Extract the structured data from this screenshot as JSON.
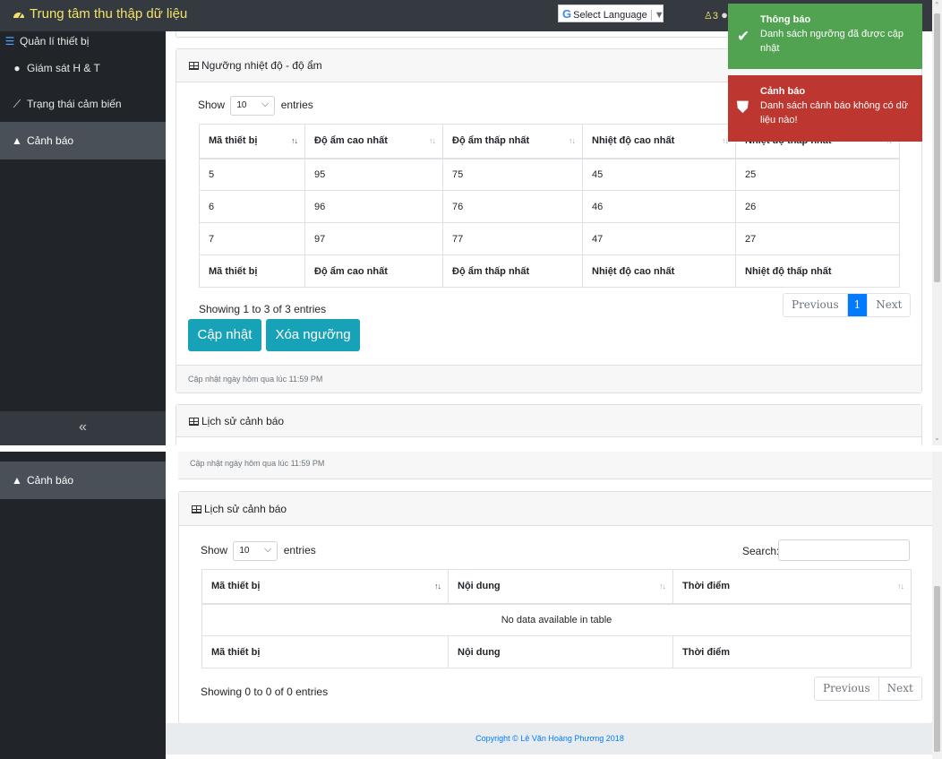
{
  "colors": {
    "navbar": "#343a40",
    "sidebar": "#212529",
    "brand": "#f1e36a",
    "button": "#17a2b8",
    "toast_success": "#51a351",
    "toast_error": "#bd362f",
    "page_active": "#007bff"
  },
  "navbar": {
    "brand": "Trung tâm thu thập dữ liệu",
    "brand_icon": "dashboard-icon",
    "language_label": "Select Language",
    "language_arrow": "▼",
    "notif_count": "3"
  },
  "sidebar": {
    "group_label": "Quản lí thiết bị",
    "items": [
      {
        "label": "Giám sát H & T",
        "icon": "info-circle-icon"
      },
      {
        "label": "Trạng thái cảm biến",
        "icon": "area-chart-icon"
      },
      {
        "label": "Cảnh báo",
        "icon": "warning-icon"
      }
    ],
    "collapse_label": "«"
  },
  "threshold_card": {
    "title": "Ngưỡng nhiệt độ - độ ẩm",
    "show_label": "Show",
    "entries_value": "10",
    "entries_label": "entries",
    "columns": [
      "Mã thiết bị",
      "Độ ẩm cao nhất",
      "Độ ẩm thấp nhất",
      "Nhiệt độ cao nhất",
      "Nhiệt độ thấp nhất"
    ],
    "rows": [
      [
        "5",
        "95",
        "75",
        "45",
        "25"
      ],
      [
        "6",
        "96",
        "76",
        "46",
        "26"
      ],
      [
        "7",
        "97",
        "77",
        "47",
        "27"
      ]
    ],
    "info": "Showing 1 to 3 of 3 entries",
    "prev_label": "Previous",
    "current_page": "1",
    "next_label": "Next",
    "update_button": "Cập nhật",
    "delete_button": "Xóa ngưỡng",
    "footer": "Cập nhật ngày hôm qua lúc 11:59 PM"
  },
  "alert_card": {
    "title": "Lịch sử cảnh báo",
    "show_label": "Show",
    "entries_value": "10",
    "entries_label": "entries",
    "search_label": "Search:",
    "columns": [
      "Mã thiết bị",
      "Nội dung",
      "Thời điểm"
    ],
    "empty_message": "No data available in table",
    "info": "Showing 0 to 0 of 0 entries",
    "prev_label": "Previous",
    "next_label": "Next"
  },
  "footer": {
    "copyright": "Copyright © Lê Văn Hoàng Phương 2018"
  },
  "toasts": {
    "success": {
      "title": "Thông báo",
      "message": "Danh sách ngưỡng đã được cập nhật"
    },
    "error": {
      "title": "Cảnh báo",
      "message": "Danh sách cảnh báo không có dữ liệu nào!"
    }
  }
}
